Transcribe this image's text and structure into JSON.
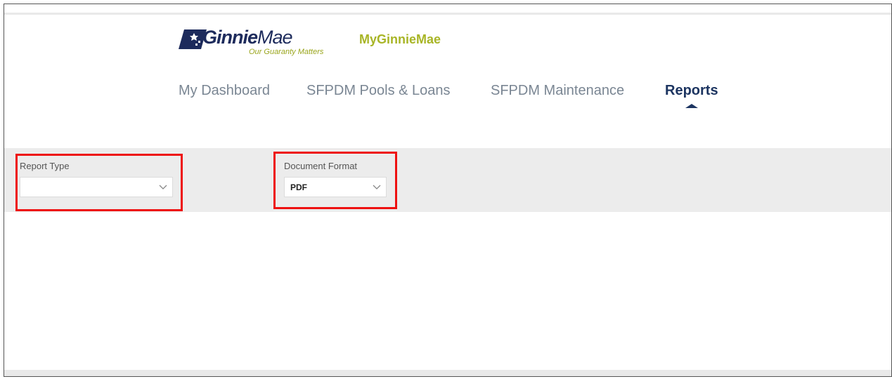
{
  "brand": {
    "logo_word_bold": "Ginnie",
    "logo_word_light": "Mae",
    "tagline": "Our Guaranty Matters",
    "portal_name": "MyGinnieMae",
    "logo_color": "#1d2b5c",
    "accent_color": "#a8b526"
  },
  "nav": {
    "items": [
      {
        "label": "My Dashboard",
        "active": false
      },
      {
        "label": "SFPDM Pools & Loans",
        "active": false
      },
      {
        "label": "SFPDM Maintenance",
        "active": false
      },
      {
        "label": "Reports",
        "active": true
      }
    ]
  },
  "filters": {
    "report_type": {
      "label": "Report Type",
      "value": ""
    },
    "document_format": {
      "label": "Document Format",
      "value": "PDF"
    }
  },
  "icons": {
    "logo": "ginnie-mae-logo-icon",
    "dropdown": "chevron-down-icon",
    "active_tab": "caret-up-icon"
  },
  "colors": {
    "highlight_border": "#ee1111",
    "active_nav": "#1d3561",
    "inactive_nav": "#7a8693",
    "filter_bar_bg": "#ececec"
  }
}
